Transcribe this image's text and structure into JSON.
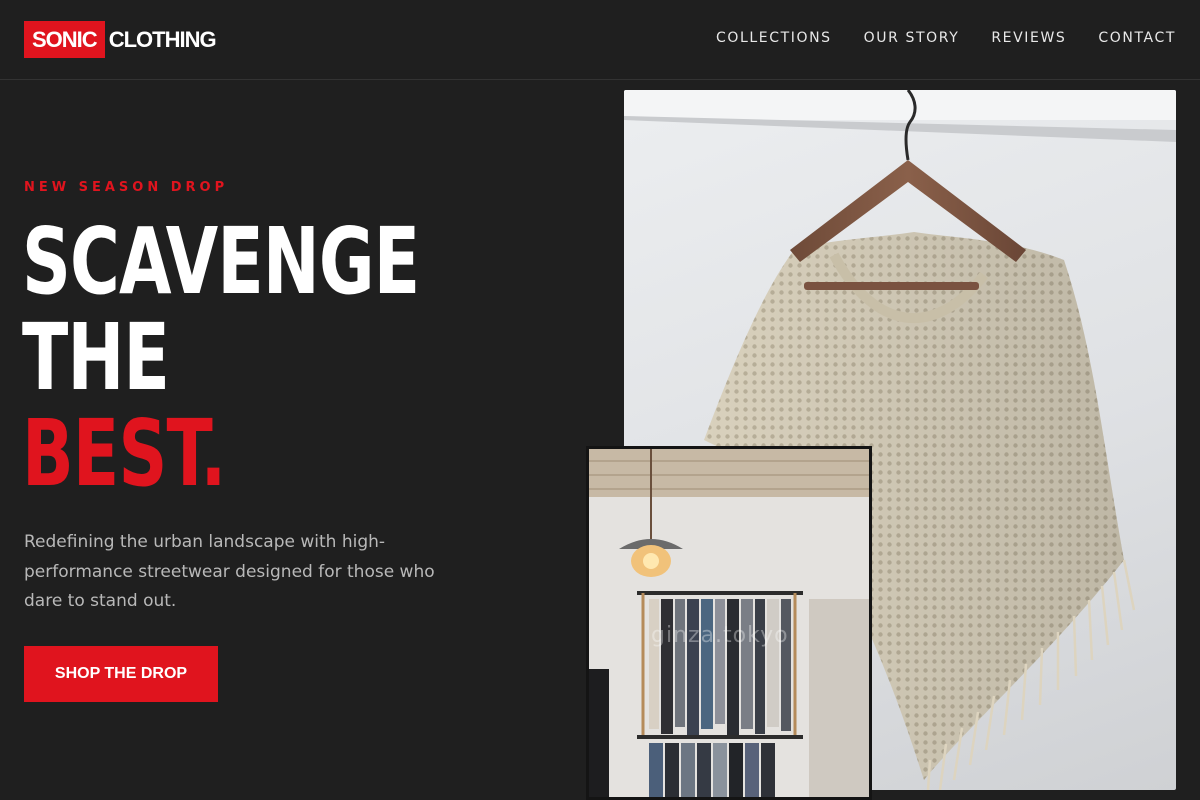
{
  "brand": {
    "highlight": "SONIC",
    "rest": "CLOTHING",
    "accent_color": "#e0141e"
  },
  "nav": {
    "items": [
      "COLLECTIONS",
      "OUR STORY",
      "REVIEWS",
      "CONTACT"
    ]
  },
  "hero": {
    "eyebrow": "NEW SEASON DROP",
    "headline_line1": "SCAVENGE",
    "headline_line2": "THE",
    "headline_line3": "BEST.",
    "description": "Redefining the urban landscape with high-performance streetwear designed for those who dare to stand out.",
    "cta_label": "SHOP THE DROP"
  },
  "images": {
    "main": "knit-poncho-on-hanger-photo",
    "inset": "clothing-store-interior-photo",
    "inset_watermark": "ginza.tokyo"
  }
}
